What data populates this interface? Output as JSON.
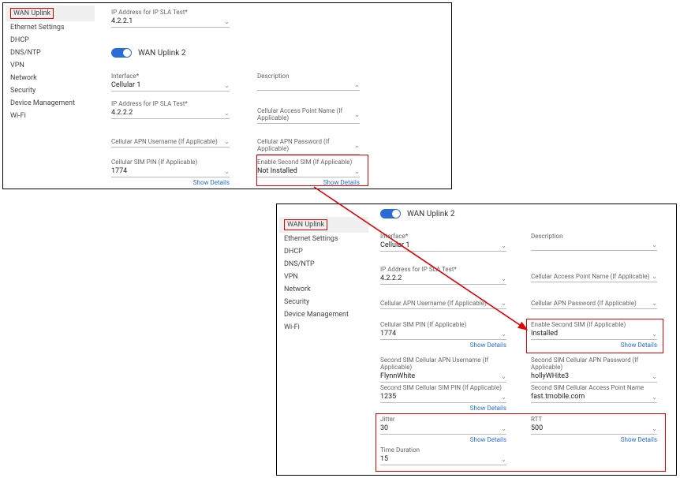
{
  "sidebar": {
    "items": [
      {
        "label": "WAN Uplink"
      },
      {
        "label": "Ethernet Settings"
      },
      {
        "label": "DHCP"
      },
      {
        "label": "DNS/NTP"
      },
      {
        "label": "VPN"
      },
      {
        "label": "Network"
      },
      {
        "label": "Security"
      },
      {
        "label": "Device Management"
      },
      {
        "label": "Wi-Fi"
      }
    ]
  },
  "panelA": {
    "ipSlaTop": {
      "label": "IP Address for IP SLA Test*",
      "value": "4.2.2.1"
    },
    "sectionTitle": "WAN Uplink 2",
    "interface": {
      "label": "Interface*",
      "value": "Cellular 1"
    },
    "description": {
      "label": "Description",
      "value": ""
    },
    "ipSla": {
      "label": "IP Address for IP SLA Test*",
      "value": "4.2.2.2"
    },
    "apn": {
      "label": "Cellular Access Point Name (If Applicable)",
      "value": ""
    },
    "apnUser": {
      "label": "Cellular APN Username (If Applicable)",
      "value": ""
    },
    "apnPass": {
      "label": "Cellular APN Password (If Applicable)",
      "value": ""
    },
    "simPin": {
      "label": "Cellular SIM PIN (If Applicable)",
      "value": "1774"
    },
    "secondSim": {
      "label": "Enable Second SIM (If Applicable)",
      "value": "Not Installed"
    },
    "showDetails": "Show Details"
  },
  "panelB": {
    "sectionTitle": "WAN Uplink 2",
    "interface": {
      "label": "Interface*",
      "value": "Cellular 1"
    },
    "description": {
      "label": "Description",
      "value": ""
    },
    "ipSla": {
      "label": "IP Address for IP SLA Test*",
      "value": "4.2.2.2"
    },
    "apn": {
      "label": "Cellular Access Point Name (If Applicable)",
      "value": ""
    },
    "apnUser": {
      "label": "Cellular APN Username (If Applicable)",
      "value": ""
    },
    "apnPass": {
      "label": "Cellular APN Password (If Applicable)",
      "value": ""
    },
    "simPin": {
      "label": "Cellular SIM PIN (If Applicable)",
      "value": "1774"
    },
    "secondSim": {
      "label": "Enable Second SIM (If Applicable)",
      "value": "Installed"
    },
    "sim2ApnUser": {
      "label": "Second SIM Cellular APN Username (If Applicable)",
      "value": "FlynnWhite"
    },
    "sim2ApnPass": {
      "label": "Second SIM Cellular APN Password (If Applicable)",
      "value": "hollyWHite3"
    },
    "sim2Pin": {
      "label": "Second SIM Cellular SIM PIN (If Applicable)",
      "value": "1235"
    },
    "sim2Apn": {
      "label": "Second SIM Cellular Access Point Name",
      "value": "fast.tmobile.com"
    },
    "jitter": {
      "label": "Jitter",
      "value": "30"
    },
    "rtt": {
      "label": "RTT",
      "value": "500"
    },
    "timeDur": {
      "label": "Time Duration",
      "value": "15"
    },
    "showDetails": "Show Details"
  }
}
